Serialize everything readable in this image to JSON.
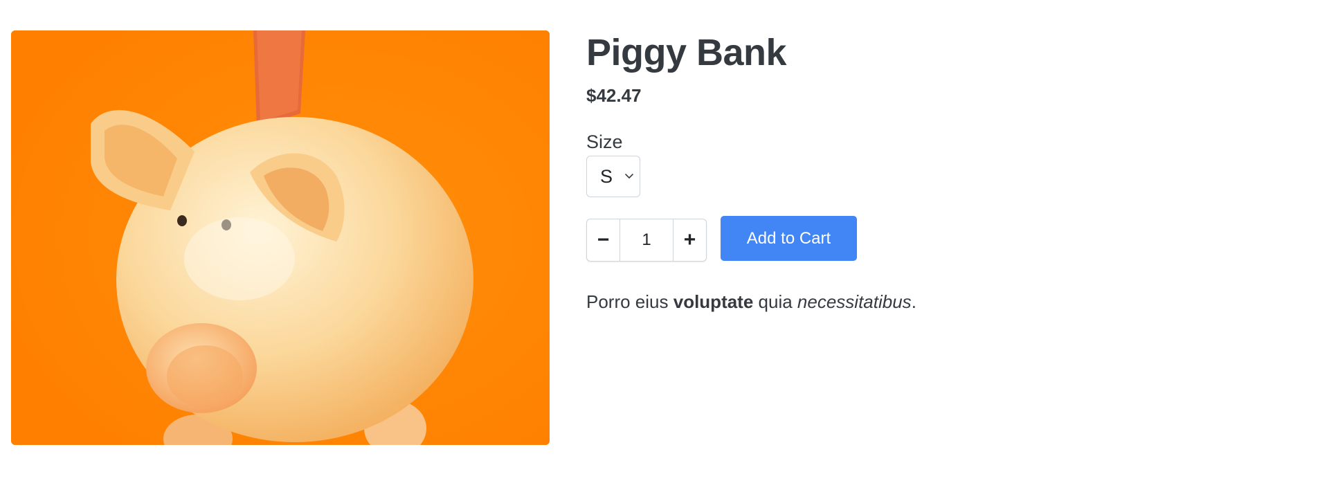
{
  "product": {
    "title": "Piggy Bank",
    "price": "$42.47",
    "image_icon": "piggy-bank-photo",
    "size": {
      "label": "Size",
      "selected": "S"
    },
    "quantity": {
      "decrement_label": "−",
      "value": "1",
      "increment_label": "+"
    },
    "add_to_cart_label": "Add to Cart",
    "description": {
      "part1": "Porro eius ",
      "bold": "voluptate",
      "part2": " quia ",
      "italic": "necessitatibus",
      "part3": "."
    }
  },
  "colors": {
    "image_background": "#ff8500",
    "button_primary": "#4285f4",
    "text": "#343a40"
  }
}
